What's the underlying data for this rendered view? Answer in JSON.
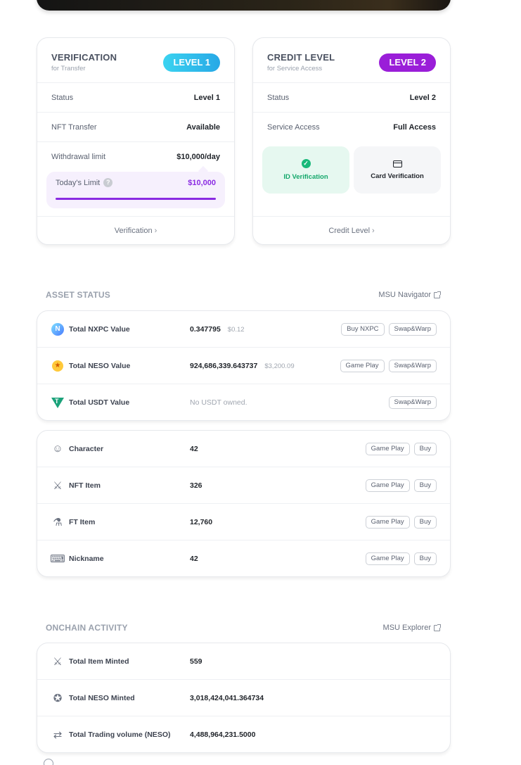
{
  "verification": {
    "title": "VERIFICATION",
    "subtitle": "for Transfer",
    "badge": "LEVEL 1",
    "rows": [
      {
        "label": "Status",
        "value": "Level 1"
      },
      {
        "label": "NFT Transfer",
        "value": "Available"
      },
      {
        "label": "Withdrawal limit",
        "value": "$10,000/day"
      }
    ],
    "today_limit_label": "Today's Limit",
    "today_limit_value": "$10,000",
    "today_limit_fraction": 1.0,
    "footer_link": "Verification"
  },
  "credit": {
    "title": "CREDIT LEVEL",
    "subtitle": "for Service Access",
    "badge": "LEVEL 2",
    "rows": [
      {
        "label": "Status",
        "value": "Level 2"
      },
      {
        "label": "Service Access",
        "value": "Full Access"
      }
    ],
    "tiles": [
      {
        "label": "ID Verification",
        "icon": "check-circle-icon"
      },
      {
        "label": "Card Verification",
        "icon": "credit-card-icon"
      }
    ],
    "footer_link": "Credit Level"
  },
  "asset_status": {
    "title": "ASSET STATUS",
    "link": "MSU Navigator",
    "tokens": [
      {
        "name": "Total NXPC Value",
        "value": "0.347795",
        "sub": "$0.12",
        "buttons": [
          "Buy NXPC",
          "Swap&Warp"
        ],
        "icon": "nxpc-icon"
      },
      {
        "name": "Total NESO Value",
        "value": "924,686,339.643737",
        "sub": "$3,200.09",
        "buttons": [
          "Game Play",
          "Swap&Warp"
        ],
        "icon": "neso-icon"
      },
      {
        "name": "Total USDT Value",
        "value": "No USDT owned.",
        "sub": "",
        "buttons": [
          "Swap&Warp"
        ],
        "icon": "usdt-icon"
      }
    ],
    "items": [
      {
        "name": "Character",
        "value": "42",
        "buttons": [
          "Game Play",
          "Buy"
        ],
        "icon": "character-icon"
      },
      {
        "name": "NFT Item",
        "value": "326",
        "buttons": [
          "Game Play",
          "Buy"
        ],
        "icon": "crossed-swords-icon"
      },
      {
        "name": "FT Item",
        "value": "12,760",
        "buttons": [
          "Game Play",
          "Buy"
        ],
        "icon": "potion-icon"
      },
      {
        "name": "Nickname",
        "value": "42",
        "buttons": [
          "Game Play",
          "Buy"
        ],
        "icon": "nickname-icon"
      }
    ]
  },
  "onchain": {
    "title": "ONCHAIN ACTIVITY",
    "link": "MSU Explorer",
    "rows": [
      {
        "name": "Total Item Minted",
        "value": "559",
        "icon": "crossed-swords-icon"
      },
      {
        "name": "Total NESO Minted",
        "value": "3,018,424,041.364734",
        "icon": "coin-icon"
      },
      {
        "name": "Total Trading volume (NESO)",
        "value": "4,488,964,231.5000",
        "icon": "swap-arrows-icon"
      }
    ]
  }
}
